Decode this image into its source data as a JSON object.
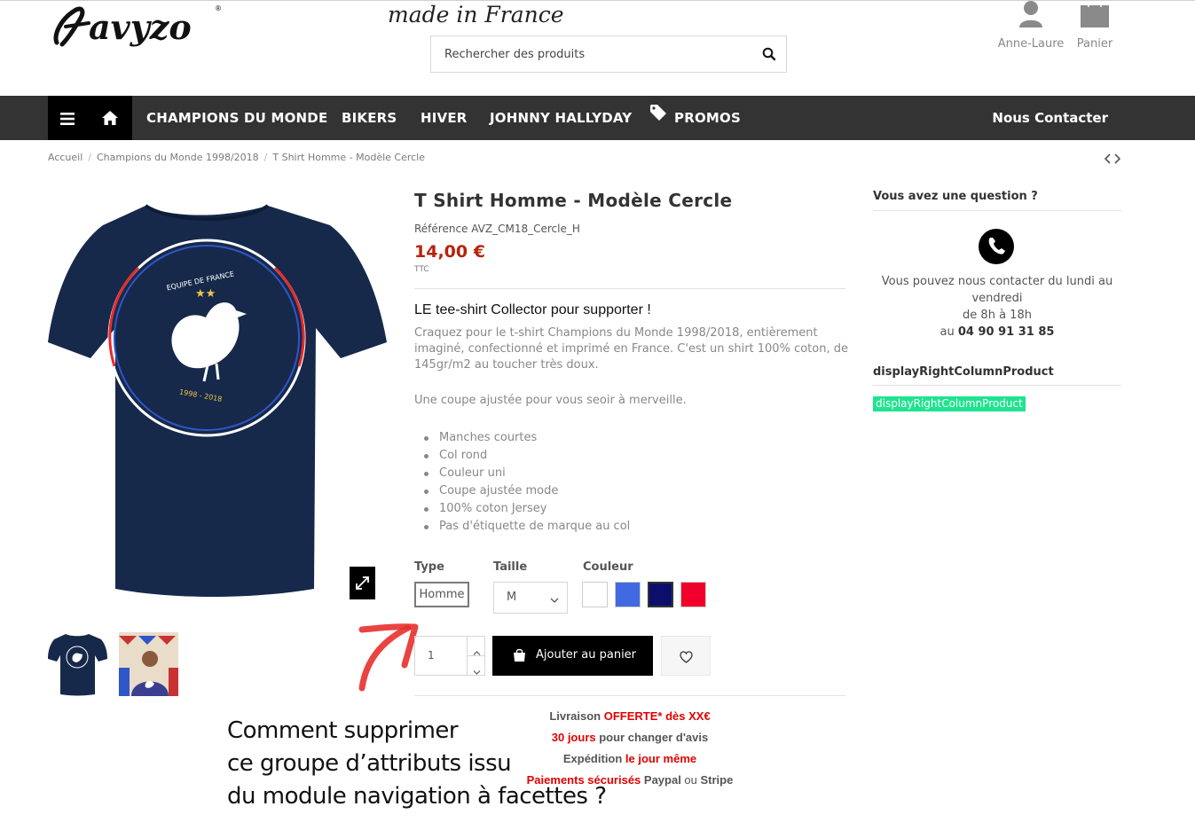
{
  "header": {
    "logo_text": "avyzo",
    "tagline": "made in France",
    "search": {
      "placeholder": "Rechercher des produits"
    },
    "account_label": "Anne-Laure",
    "cart_label": "Panier"
  },
  "nav": {
    "items": [
      "CHAMPIONS DU MONDE",
      "BIKERS",
      "HIVER",
      "JOHNNY HALLYDAY",
      "PROMOS"
    ],
    "contact_label": "Nous Contacter"
  },
  "breadcrumb": [
    "Accueil",
    "Champions du Monde 1998/2018",
    "T Shirt Homme - Modèle Cercle"
  ],
  "product": {
    "title": "T Shirt Homme - Modèle Cercle",
    "reference": "Référence AVZ_CM18_Cercle_H",
    "price": "14,00 €",
    "tax_label": "TTC",
    "subtitle": "LE tee-shirt Collector pour supporter !",
    "description_1": "Craquez pour le t-shirt Champions du Monde 1998/2018, entièrement imaginé, confectionné et imprimé en France. C'est un shirt 100% coton, de 145gr/m2 au toucher très doux.",
    "description_2": "Une coupe ajustée pour vous seoir à merveille.",
    "features": [
      "Manches courtes",
      "Col rond",
      "Couleur uni",
      "Coupe ajustée mode",
      "100% coton Jersey",
      "Pas d'étiquette de marque au col"
    ],
    "print_top": "EQUIPE DE FRANCE",
    "print_bottom": "1998 - 2018",
    "shirt_color": "#16294a"
  },
  "variants": {
    "type_label": "Type",
    "type_value": "Homme",
    "size_label": "Taille",
    "size_value": "M",
    "color_label": "Couleur",
    "colors": [
      "#ffffff",
      "#4169e1",
      "#0b0f6b",
      "#f0002a"
    ],
    "selected_color_index": 2
  },
  "cart": {
    "quantity": "1",
    "add_label": "Ajouter au panier"
  },
  "reassurance": {
    "line1": {
      "a": "Livraison ",
      "b": "OFFERTE* dès XX€"
    },
    "line2": {
      "a": "30 jours",
      "b": " pour changer d'avis"
    },
    "line3": {
      "a": "Expédition ",
      "b": "le jour même"
    },
    "line4": {
      "a": "Paiements sécurisés",
      "b": " Paypal ",
      "c": "ou",
      "d": " Stripe"
    }
  },
  "annotation": {
    "line1": "Comment supprimer",
    "line2": "ce groupe d’attributs issu",
    "line3": "du module navigation à facettes ?"
  },
  "right_column": {
    "question_title": "Vous avez une question ?",
    "contact_text": "Vous pouvez nous contacter du lundi au vendredi",
    "hours": "de 8h à 18h",
    "phone_prefix": "au ",
    "phone": "04 90 91 31 85",
    "hook_title": "displayRightColumnProduct",
    "hook_badge": "displayRightColumnProduct"
  },
  "colors": {
    "nav_bg": "#333333",
    "price": "#b6230c",
    "accent_red": "#e20000",
    "hook_green": "#1fe38f"
  }
}
